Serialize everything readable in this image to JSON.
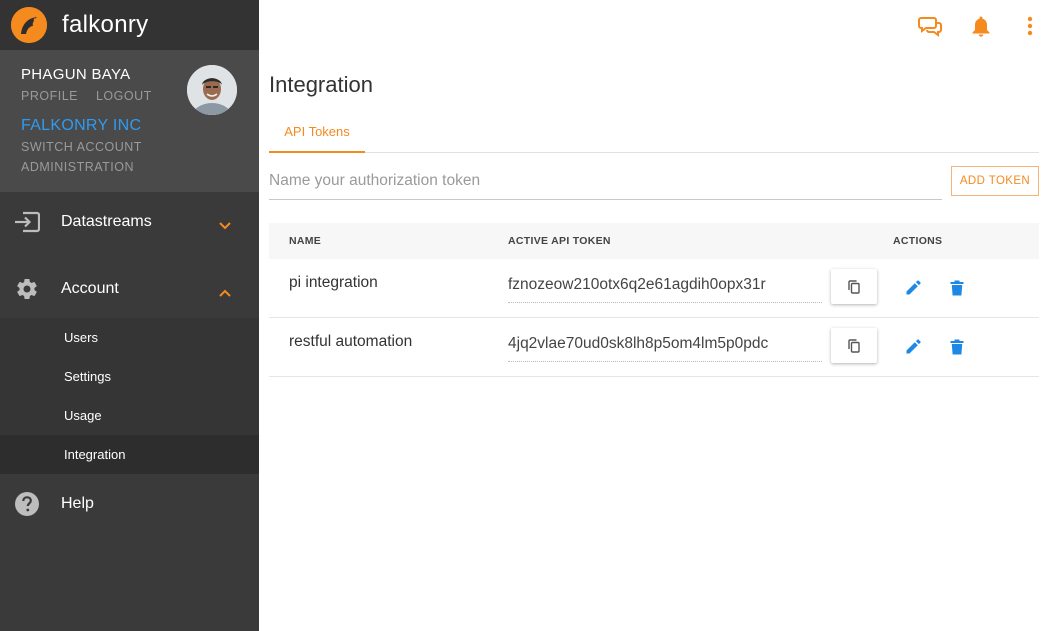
{
  "brand": {
    "name": "falkonry",
    "accent": "#f58a1f"
  },
  "user": {
    "name": "PHAGUN BAYA",
    "profile_link": "PROFILE",
    "logout_link": "LOGOUT",
    "org_name": "FALKONRY INC",
    "switch_account": "SWITCH ACCOUNT",
    "administration": "ADMINISTRATION"
  },
  "sidebar": {
    "datastreams": {
      "label": "Datastreams",
      "icon": "input-icon",
      "expanded": false
    },
    "account": {
      "label": "Account",
      "icon": "gear-icon",
      "expanded": true,
      "items": [
        {
          "label": "Users",
          "active": false
        },
        {
          "label": "Settings",
          "active": false
        },
        {
          "label": "Usage",
          "active": false
        },
        {
          "label": "Integration",
          "active": true
        }
      ]
    },
    "help": {
      "label": "Help",
      "icon": "help-icon"
    }
  },
  "topbar": {
    "icons": [
      "chat-icon",
      "bell-icon",
      "more-vert-icon"
    ]
  },
  "main": {
    "title": "Integration",
    "tabs": [
      {
        "label": "API Tokens",
        "active": true
      }
    ],
    "token_input": {
      "placeholder": "Name your authorization token",
      "value": ""
    },
    "add_token_label": "ADD TOKEN",
    "table": {
      "headers": {
        "name": "NAME",
        "token": "ACTIVE API TOKEN",
        "actions": "ACTIONS"
      },
      "rows": [
        {
          "name": "pi integration",
          "token": "fznozeow210otx6q2e61agdih0opx31r"
        },
        {
          "name": "restful automation",
          "token": "4jq2vlae70ud0sk8lh8p5om4lm5p0pdc"
        }
      ]
    }
  },
  "colors": {
    "orange": "#f58a1f",
    "blue": "#1e88e5",
    "org_blue": "#2f9bf0",
    "sidebar_bg": "#3a3a3a"
  }
}
